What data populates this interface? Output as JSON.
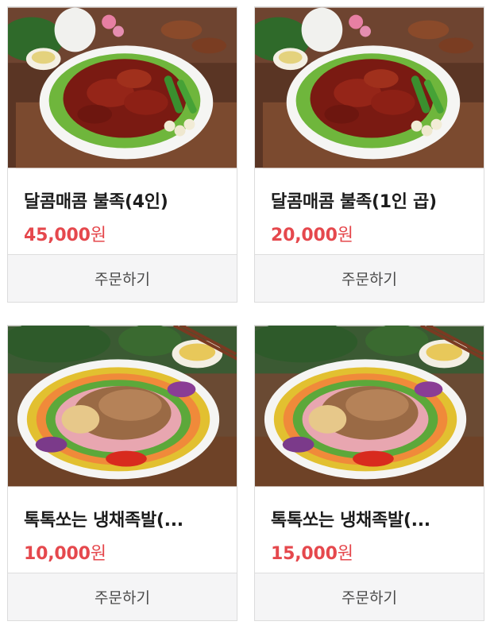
{
  "products": [
    {
      "name": "달콤매콤 불족(4인)",
      "price": "45,000",
      "currency": "원",
      "order_label": "주문하기",
      "image": "spicy-chicken-dish"
    },
    {
      "name": "달콤매콤 불족(1인 곱)",
      "price": "20,000",
      "currency": "원",
      "order_label": "주문하기",
      "image": "spicy-chicken-dish"
    },
    {
      "name": "톡톡쏘는 냉채족발(...",
      "price": "10,000",
      "currency": "원",
      "order_label": "주문하기",
      "image": "cold-pork-platter"
    },
    {
      "name": "톡톡쏘는 냉채족발(...",
      "price": "15,000",
      "currency": "원",
      "order_label": "주문하기",
      "image": "cold-pork-platter"
    }
  ],
  "colors": {
    "price": "#e5484d",
    "order_bg": "#f5f5f6",
    "border": "#dcdcdc"
  }
}
